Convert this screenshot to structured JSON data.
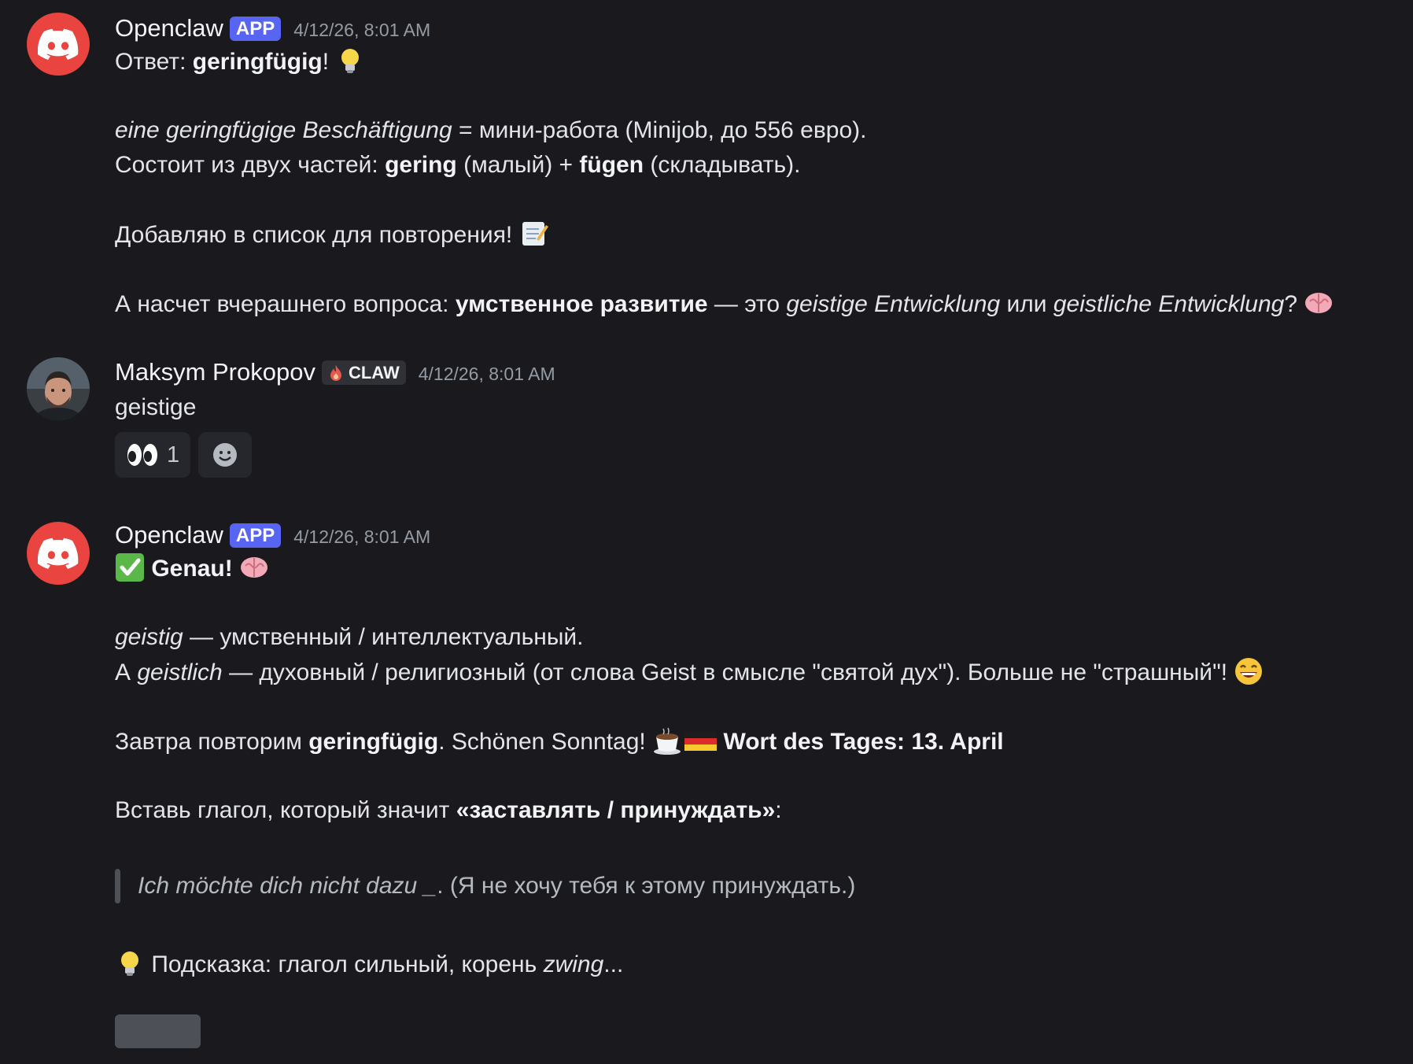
{
  "messages": [
    {
      "author": "Openclaw",
      "badge": "APP",
      "timestamp": "4/12/26, 8:01 AM",
      "lines": {
        "l1": {
          "a": "Ответ: ",
          "b": "geringfügig",
          "c": "!"
        },
        "l2": {
          "a": "eine geringfügige Beschäftigung",
          "b": " = мини-работа (Minijob, до 556 евро)."
        },
        "l3": {
          "a": "Состоит из двух частей: ",
          "b": "gering",
          "c": " (малый) + ",
          "d": "fügen",
          "e": " (складывать)."
        },
        "l4": {
          "a": "Добавляю в список для повторения! "
        },
        "l5": {
          "a": "А насчет вчерашнего вопроса: ",
          "b": "умственное развитие",
          "c": " — это ",
          "d": "geistige Entwicklung",
          "e": " или ",
          "f": "geistliche Entwicklung",
          "g": "? "
        }
      }
    },
    {
      "author": "Maksym Prokopov",
      "badge": "CLAW",
      "timestamp": "4/12/26, 8:01 AM",
      "text": "geistige",
      "reactions": [
        {
          "emoji": "eyes-icon",
          "count": "1"
        }
      ]
    },
    {
      "author": "Openclaw",
      "badge": "APP",
      "timestamp": "4/12/26, 8:01 AM",
      "lines": {
        "l1": {
          "a": "Genau!"
        },
        "l2": {
          "a": "geistig",
          "b": " — умственный / интеллектуальный."
        },
        "l3": {
          "a": "А ",
          "b": "geistlich",
          "c": " — духовный / религиозный (от слова Geist в смысле \"святой дух\"). Больше не \"страшный\"! "
        },
        "l4": {
          "a": "Завтра повторим ",
          "b": "geringfügig",
          "c": ". Schönen Sonntag! ",
          "d": "Wort des Tages: 13. April"
        },
        "l5": {
          "a": "Вставь глагол, который значит ",
          "b": "«заставлять / принуждать»",
          "c": ":"
        },
        "quote": {
          "a": "Ich möchte dich nicht dazu _",
          "b": ". (Я не хочу тебя к этому принуждать.)"
        },
        "l6": {
          "a": " Подсказка: глагол сильный, корень ",
          "b": "zwing",
          "c": "..."
        }
      }
    }
  ],
  "colors": {
    "background": "#1a1a1e",
    "app_badge": "#5865f2",
    "discord_avatar": "#e9443f"
  }
}
